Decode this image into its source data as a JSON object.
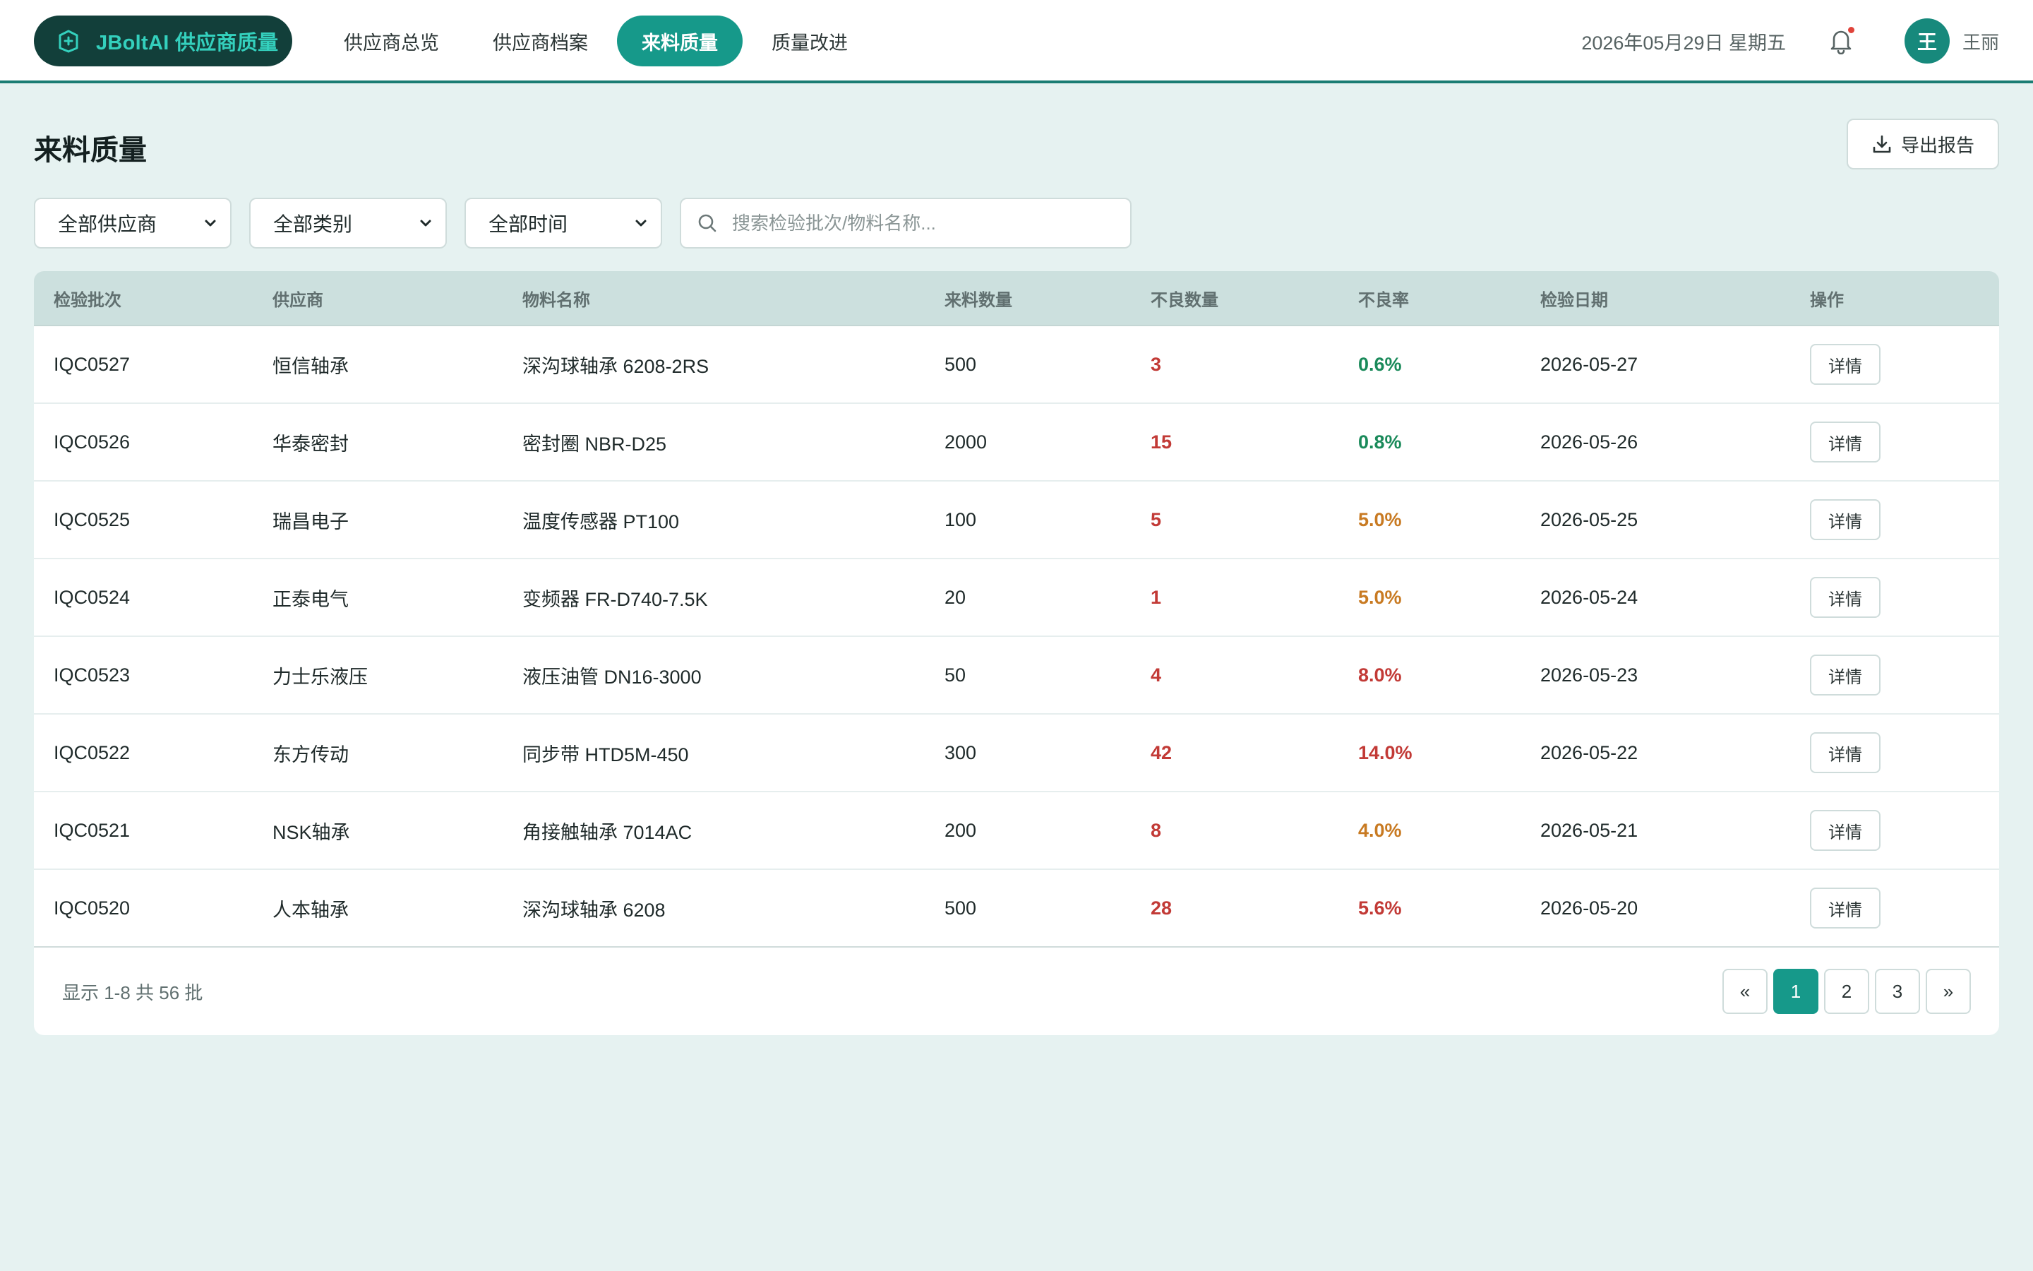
{
  "header": {
    "brand": "JBoltAI 供应商质量",
    "nav": [
      {
        "label": "供应商总览",
        "active": false
      },
      {
        "label": "供应商档案",
        "active": false
      },
      {
        "label": "来料质量",
        "active": true
      },
      {
        "label": "质量改进",
        "active": false
      }
    ],
    "date": "2026年05月29日 星期五",
    "avatar_initial": "王",
    "user_name": "王丽"
  },
  "page": {
    "title": "来料质量",
    "export_label": "导出报告"
  },
  "filters": {
    "supplier": "全部供应商",
    "category": "全部类别",
    "time": "全部时间",
    "search_placeholder": "搜索检验批次/物料名称..."
  },
  "table": {
    "columns": [
      "检验批次",
      "供应商",
      "物料名称",
      "来料数量",
      "不良数量",
      "不良率",
      "检验日期",
      "操作"
    ],
    "rows": [
      {
        "batch": "IQC0527",
        "supplier": "恒信轴承",
        "material": "深沟球轴承 6208-2RS",
        "qty": "500",
        "defects": "3",
        "rate": "0.6%",
        "rate_color": "#1a8a5a",
        "date": "2026-05-27",
        "action": "详情"
      },
      {
        "batch": "IQC0526",
        "supplier": "华泰密封",
        "material": "密封圈 NBR-D25",
        "qty": "2000",
        "defects": "15",
        "rate": "0.8%",
        "rate_color": "#1a8a5a",
        "date": "2026-05-26",
        "action": "详情"
      },
      {
        "batch": "IQC0525",
        "supplier": "瑞昌电子",
        "material": "温度传感器 PT100",
        "qty": "100",
        "defects": "5",
        "rate": "5.0%",
        "rate_color": "#c87a22",
        "date": "2026-05-25",
        "action": "详情"
      },
      {
        "batch": "IQC0524",
        "supplier": "正泰电气",
        "material": "变频器 FR-D740-7.5K",
        "qty": "20",
        "defects": "1",
        "rate": "5.0%",
        "rate_color": "#c87a22",
        "date": "2026-05-24",
        "action": "详情"
      },
      {
        "batch": "IQC0523",
        "supplier": "力士乐液压",
        "material": "液压油管 DN16-3000",
        "qty": "50",
        "defects": "4",
        "rate": "8.0%",
        "rate_color": "#c23a36",
        "date": "2026-05-23",
        "action": "详情"
      },
      {
        "batch": "IQC0522",
        "supplier": "东方传动",
        "material": "同步带 HTD5M-450",
        "qty": "300",
        "defects": "42",
        "rate": "14.0%",
        "rate_color": "#c23a36",
        "date": "2026-05-22",
        "action": "详情"
      },
      {
        "batch": "IQC0521",
        "supplier": "NSK轴承",
        "material": "角接触轴承 7014AC",
        "qty": "200",
        "defects": "8",
        "rate": "4.0%",
        "rate_color": "#c87a22",
        "date": "2026-05-21",
        "action": "详情"
      },
      {
        "batch": "IQC0520",
        "supplier": "人本轴承",
        "material": "深沟球轴承 6208",
        "qty": "500",
        "defects": "28",
        "rate": "5.6%",
        "rate_color": "#c23a36",
        "date": "2026-05-20",
        "action": "详情"
      }
    ]
  },
  "footer": {
    "summary": "显示 1-8 共 56 批",
    "pages": [
      {
        "label": "«",
        "name": "prev",
        "active": false
      },
      {
        "label": "1",
        "name": "1",
        "active": true
      },
      {
        "label": "2",
        "name": "2",
        "active": false
      },
      {
        "label": "3",
        "name": "3",
        "active": false
      },
      {
        "label": "»",
        "name": "next",
        "active": false
      }
    ]
  },
  "colors": {
    "accent": "#16998a",
    "brand_bg": "#123f3a",
    "good": "#1a8a5a",
    "warn": "#c87a22",
    "bad": "#c23a36"
  },
  "icons": [
    "box-plus-icon",
    "bell-icon",
    "download-icon",
    "chevron-down-icon",
    "search-icon"
  ]
}
